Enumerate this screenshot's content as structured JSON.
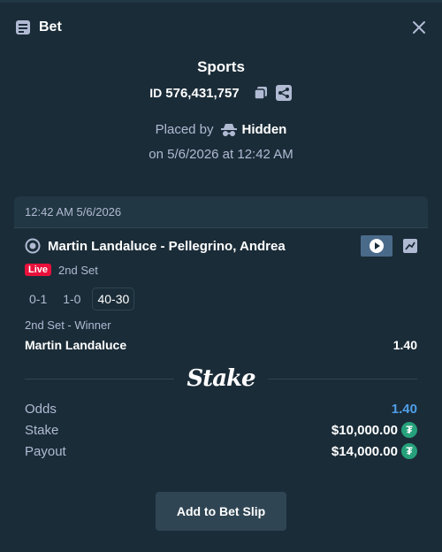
{
  "header": {
    "title": "Bet"
  },
  "summary": {
    "sport": "Sports",
    "id_label": "ID",
    "id_value": "576,431,757",
    "placed_by_label": "Placed by",
    "placed_by_name": "Hidden",
    "placed_date": "on 5/6/2026 at 12:42 AM"
  },
  "card": {
    "timestamp": "12:42 AM 5/6/2026",
    "match_name": "Martin Landaluce - Pellegrino, Andrea",
    "live_label": "Live",
    "period": "2nd Set",
    "scores": [
      "0-1",
      "1-0",
      "40-30"
    ],
    "market": "2nd Set - Winner",
    "selection": "Martin Landaluce",
    "selection_odds": "1.40",
    "brand": "Stake",
    "totals": {
      "odds_label": "Odds",
      "odds_value": "1.40",
      "stake_label": "Stake",
      "stake_value": "$10,000.00",
      "payout_label": "Payout",
      "payout_value": "$14,000.00",
      "currency_icon": "₮"
    }
  },
  "actions": {
    "add_label": "Add to Bet Slip"
  },
  "colors": {
    "live": "#e9113c",
    "odds_accent": "#4f9fe8",
    "tether": "#26a17b"
  }
}
